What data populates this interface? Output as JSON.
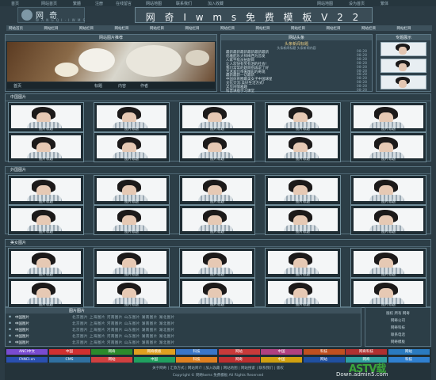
{
  "topbar": {
    "items": [
      "首页",
      "网站首页",
      "繁體",
      "注册",
      "在线留言",
      "网站地图",
      "联系我们",
      "加入收藏",
      "网站地图",
      "设为首页",
      "繁体"
    ]
  },
  "logo": {
    "main": "网 奇",
    "sub": "W A N G Q I · I W M S"
  },
  "title": "网 奇 I w m s 免 费 模 板 V 2 2",
  "nav": {
    "items": [
      "网站首页",
      "网站栏目",
      "网站栏目",
      "网站栏目",
      "网站栏目",
      "网站栏目",
      "网站栏目",
      "网站栏目",
      "网站栏目",
      "网站栏目",
      "网站栏目",
      "网站栏目"
    ]
  },
  "hero": {
    "caption": "网站图片推荐",
    "bar": [
      "首页",
      "标题",
      "内容",
      "作者"
    ]
  },
  "news": {
    "caption": "网站头条",
    "headline": "头条新闻标题",
    "subline": "头条新闻标题 头条新闻内容",
    "items": [
      {
        "title": "最新最新最新最新最新最新",
        "date": "08-28"
      },
      {
        "title": "优雅配乐大师梅西为首发",
        "date": "08-28"
      },
      {
        "title": "人家宇航员拍题目",
        "date": "08-28"
      },
      {
        "title": "让人欢快有笑有泪的社会!",
        "date": "08-28"
      },
      {
        "title": "我们常常的题目别再说了好",
        "date": "08-28"
      },
      {
        "title": "艺术家们带来精彩的奇观",
        "date": "08-28"
      },
      {
        "title": "最新最新一切最新",
        "date": "08-28"
      },
      {
        "title": "中国体育圈最美女子中国球星",
        "date": "08-28"
      },
      {
        "title": "文化交流:美好生活方式!",
        "date": "08-28"
      },
      {
        "title": "又见闲情雅趣",
        "date": "08-28"
      },
      {
        "title": "科普讲座学习课堂",
        "date": "08-28"
      }
    ]
  },
  "recommend": {
    "caption": "专题展示"
  },
  "sections": [
    {
      "caption": "中国图片"
    },
    {
      "caption": "外国图片"
    },
    {
      "caption": "美女图片"
    }
  ],
  "card_label": "图片标题",
  "list": {
    "caption": "图片图片",
    "rows": [
      {
        "a": "中国图片",
        "c": "北京图片  上海图片  河南图片  山东图片  湖南图片  湖北图片"
      },
      {
        "a": "中国图片",
        "c": "北京图片  上海图片  河南图片  山东图片  湖南图片  湖北图片"
      },
      {
        "a": "中国图片",
        "c": "北京图片  上海图片  河南图片  山东图片  湖南图片  湖北图片"
      },
      {
        "a": "中国图片",
        "c": "北京图片  上海图片  河南图片  山东图片  湖南图片  湖北图片"
      },
      {
        "a": "中国图片",
        "c": "北京图片  上海图片  河南图片  山东图片  湖南图片  湖北图片"
      }
    ]
  },
  "side": {
    "lines": [
      "版权 所有  网奇",
      "网奇公司",
      "网奇科技",
      "联系电话",
      "网奇模板"
    ]
  },
  "links": {
    "row1": [
      {
        "label": "ANCI中文",
        "color": "#7a4bd0"
      },
      {
        "label": "中国",
        "color": "#d03030"
      },
      {
        "label": "网奇",
        "color": "#2c8a2c"
      },
      {
        "label": "网奇模板",
        "color": "#e0a020"
      },
      {
        "label": "科技",
        "color": "#3a76c8"
      },
      {
        "label": "网站",
        "color": "#c83a3a"
      },
      {
        "label": "中国",
        "color": "#b04080"
      },
      {
        "label": "科技",
        "color": "#c05020"
      },
      {
        "label": "网奇科技",
        "color": "#b03030"
      },
      {
        "label": "网站",
        "color": "#2a7ac0"
      }
    ],
    "row2": [
      {
        "label": "FANCI.cn",
        "color": "#2a50b0"
      },
      {
        "label": "CMS",
        "color": "#3070a0"
      },
      {
        "label": "网站",
        "color": "#d04040"
      },
      {
        "label": "中国",
        "color": "#20a060"
      },
      {
        "label": "科技",
        "color": "#e08020"
      },
      {
        "label": "网奇",
        "color": "#c03030"
      },
      {
        "label": "中国",
        "color": "#d0a010"
      },
      {
        "label": "网站",
        "color": "#2050a0"
      },
      {
        "label": "网奇",
        "color": "#30a0a0"
      },
      {
        "label": "科技",
        "color": "#3080d0"
      }
    ]
  },
  "footer": {
    "line1": "关于网奇 | 汇款方式 | 网站简介 | 加入收藏 | 网站地图 | 网站搜索 | 联系我们 | 版权",
    "line2": "Copyright © 网奇Iwms 免费模板 All Rights Reserved"
  },
  "watermark": {
    "main": "ASTV载",
    "url": "Down.admin5.com"
  }
}
